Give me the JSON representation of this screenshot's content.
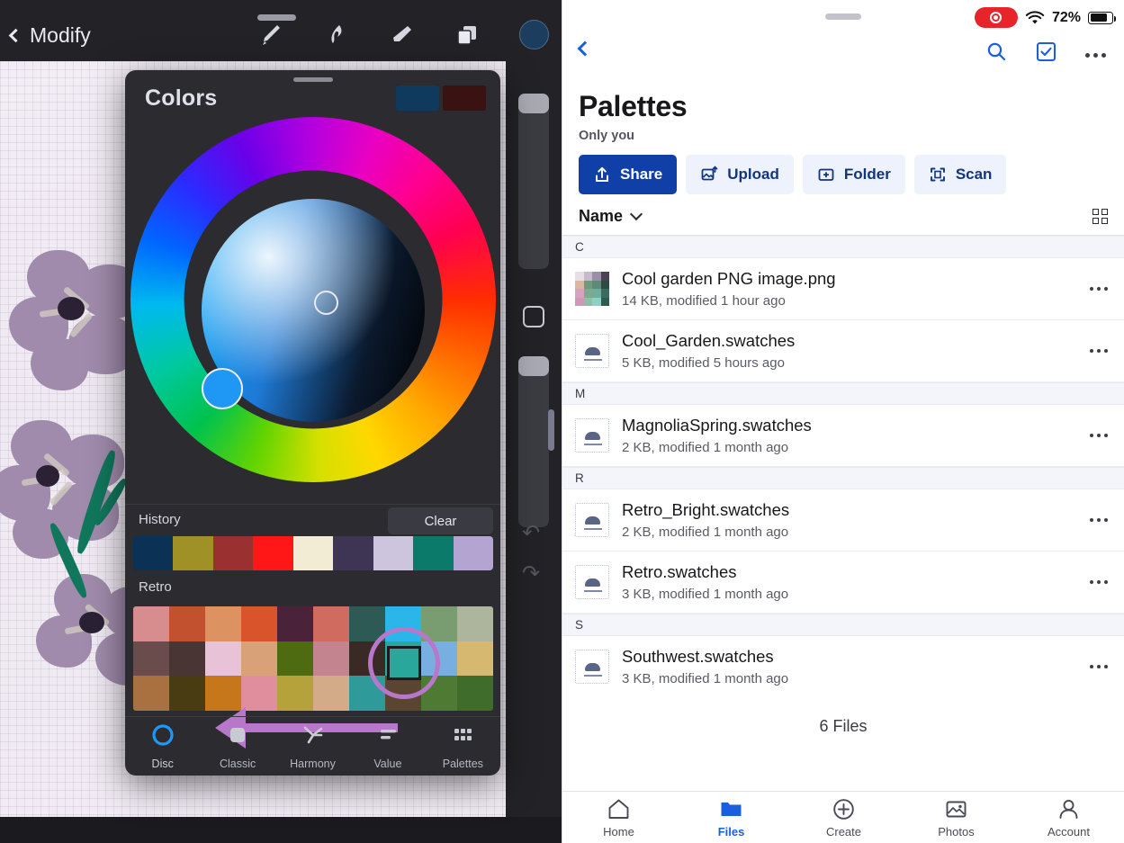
{
  "procreate": {
    "toolbar": {
      "back_label": "Modify",
      "icons": [
        "brush-icon",
        "smudge-icon",
        "eraser-icon",
        "layers-icon",
        "color-swatch-icon"
      ],
      "active_color": "#1c3d5e"
    },
    "panel": {
      "title": "Colors",
      "swatch_primary": "#10395e",
      "swatch_secondary": "#3a1212",
      "history_label": "History",
      "clear_label": "Clear",
      "palette_name": "Retro",
      "history_colors": [
        "#0b3154",
        "#a09126",
        "#9b3030",
        "#ff1717",
        "#f2ecd4",
        "#3d3553",
        "#cdc4dd",
        "#0c7a6a",
        "#b3a4d2"
      ],
      "retro_colors": [
        "#d78d8d",
        "#c2522f",
        "#dd9361",
        "#d9542a",
        "#4a2239",
        "#cf6b5f",
        "#2d5a55",
        "#2bb6ea",
        "#7a9c71",
        "#adb69d",
        "#6a4c4c",
        "#4a3535",
        "#e8c3d8",
        "#d9a177",
        "#4f6b12",
        "#c4848f",
        "#3a2a26",
        "#2aa79b",
        "#79aee0",
        "#d7b871",
        "#a8713f",
        "#4a3c12",
        "#c6761b",
        "#e08d9e",
        "#b6a23a",
        "#d4ab88",
        "#2e9a9a",
        "#5a4530",
        "#4e7a33",
        "#3f6b2b"
      ],
      "selected_swatch": "#2aa79b",
      "tabs": [
        {
          "label": "Disc",
          "icon": "disc-icon",
          "active": true
        },
        {
          "label": "Classic",
          "icon": "classic-square-icon",
          "active": false
        },
        {
          "label": "Harmony",
          "icon": "harmony-icon",
          "active": false
        },
        {
          "label": "Value",
          "icon": "value-sliders-icon",
          "active": false
        },
        {
          "label": "Palettes",
          "icon": "palettes-grid-icon",
          "active": false
        }
      ]
    }
  },
  "files_app": {
    "status": {
      "recording_label": "recording-indicator",
      "wifi": "wifi-icon",
      "battery_pct": "72%"
    },
    "nav": {
      "back": "back-chevron-icon",
      "search": "search-icon",
      "select": "select-checkbox-icon",
      "more": "more-options-icon"
    },
    "header": {
      "title": "Palettes",
      "subtitle": "Only you"
    },
    "actions": [
      {
        "label": "Share",
        "icon": "share-icon",
        "primary": true
      },
      {
        "label": "Upload",
        "icon": "upload-image-icon",
        "primary": false
      },
      {
        "label": "Folder",
        "icon": "new-folder-icon",
        "primary": false
      },
      {
        "label": "Scan",
        "icon": "scan-icon",
        "primary": false
      }
    ],
    "sort": {
      "label": "Name",
      "direction_icon": "chevron-down-icon",
      "view_toggle_icon": "grid-view-icon"
    },
    "groups": [
      {
        "letter": "C",
        "files": [
          {
            "name": "Cool garden PNG image.png",
            "meta": "14 KB, modified 1 hour ago",
            "type": "image",
            "thumb": [
              "#e8dfe6",
              "#c9b9cd",
              "#9c8fa8",
              "#4a4352",
              "#d9b7a0",
              "#6f9a7e",
              "#5f8a77",
              "#2e4a44",
              "#d5a3c0",
              "#7fa98e",
              "#6fae9e",
              "#3c6b5e",
              "#cf98b4",
              "#8fbfa8",
              "#8fd0c4",
              "#2e5a52"
            ]
          },
          {
            "name": "Cool_Garden.swatches",
            "meta": "5 KB, modified 5 hours ago",
            "type": "swatches"
          }
        ]
      },
      {
        "letter": "M",
        "files": [
          {
            "name": "MagnoliaSpring.swatches",
            "meta": "2 KB, modified 1 month ago",
            "type": "swatches"
          }
        ]
      },
      {
        "letter": "R",
        "files": [
          {
            "name": "Retro_Bright.swatches",
            "meta": "2 KB, modified 1 month ago",
            "type": "swatches"
          },
          {
            "name": "Retro.swatches",
            "meta": "3 KB, modified 1 month ago",
            "type": "swatches"
          }
        ]
      },
      {
        "letter": "S",
        "files": [
          {
            "name": "Southwest.swatches",
            "meta": "3 KB, modified 1 month ago",
            "type": "swatches"
          }
        ]
      }
    ],
    "footer_count": "6 Files",
    "tabbar": [
      {
        "label": "Home",
        "icon": "home-icon",
        "active": false
      },
      {
        "label": "Files",
        "icon": "folder-icon",
        "active": true
      },
      {
        "label": "Create",
        "icon": "plus-circle-icon",
        "active": false
      },
      {
        "label": "Photos",
        "icon": "photo-icon",
        "active": false
      },
      {
        "label": "Account",
        "icon": "person-icon",
        "active": false
      }
    ]
  }
}
